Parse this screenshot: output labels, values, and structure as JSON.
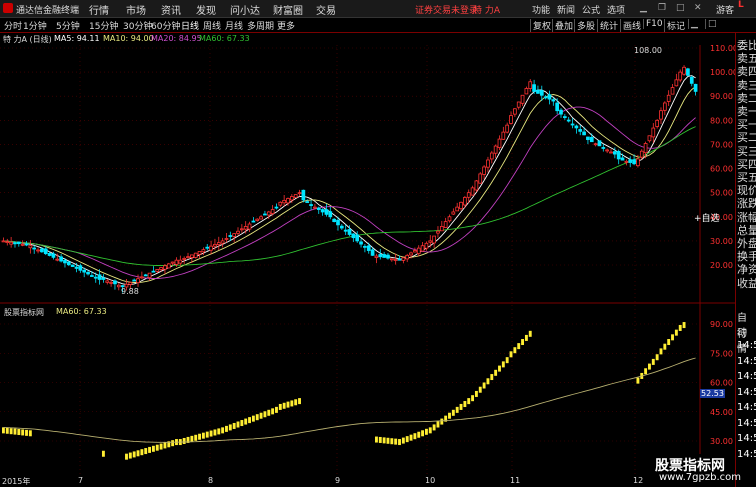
{
  "titlebar": {
    "app_title": "通达信金融终端",
    "menus": [
      "行情",
      "市场",
      "资讯",
      "发现",
      "问小达",
      "财富圈",
      "交易"
    ],
    "notice": "证券交易未登录",
    "stock": "特 力A",
    "right_menus": [
      "功能",
      "新闻",
      "公式",
      "选项"
    ],
    "guest": "游客"
  },
  "toolbar": {
    "periods": [
      "分时",
      "1分钟",
      "5分钟",
      "15分钟",
      "30分钟",
      "60分钟",
      "日线",
      "周线",
      "月线",
      "多周期",
      "更多"
    ],
    "active": "日线",
    "right_buttons": [
      "复权",
      "叠加",
      "多股",
      "统计",
      "画线",
      "F10",
      "标记"
    ]
  },
  "infobar": {
    "title": "特 力A (日线)",
    "ma5": "MA5: 94.11",
    "ma10": "MA10: 94.00",
    "ma20": "MA20: 84.95",
    "ma60": "MA60: 67.33"
  },
  "colors": {
    "up": "#ff3232",
    "down": "#00e5ff",
    "ma5": "#ffffff",
    "ma10": "#e8e880",
    "ma20": "#c040c0",
    "ma60": "#30c030",
    "grid": "#7a0000",
    "indicator": "#ffee33"
  },
  "main_axis": {
    "labels": [
      "110.00",
      "100.00",
      "90.00",
      "80.00",
      "70.00",
      "60.00",
      "50.00",
      "40.00",
      "30.00",
      "20.00"
    ],
    "high_label": "108.00",
    "low_label": "9.88"
  },
  "sidebar": {
    "header": "L",
    "items": [
      "委比",
      "卖五",
      "卖四",
      "卖三",
      "卖二",
      "卖一",
      "买一",
      "买二",
      "买三",
      "买四",
      "买五",
      "现价",
      "涨跌",
      "涨幅",
      "总量",
      "外盘",
      "换手",
      "净资",
      "收益"
    ],
    "lower": [
      "自动",
      "行情",
      "14:56",
      "14:56",
      "14:56",
      "14:56",
      "14:56",
      "14:56",
      "14:56",
      "14:56"
    ],
    "auto_select": "+自选"
  },
  "indicator": {
    "name": "股票指标网",
    "ma60": "MA60: 67.33",
    "axis_labels": [
      "90.00",
      "75.00",
      "60.00",
      "45.00",
      "30.00"
    ],
    "current_value": "52.53"
  },
  "dates": [
    "2015年",
    "7",
    "8",
    "9",
    "10",
    "11",
    "12"
  ],
  "watermark": {
    "line1": "股票指标网",
    "line2": "www.7gpzb.com"
  }
}
